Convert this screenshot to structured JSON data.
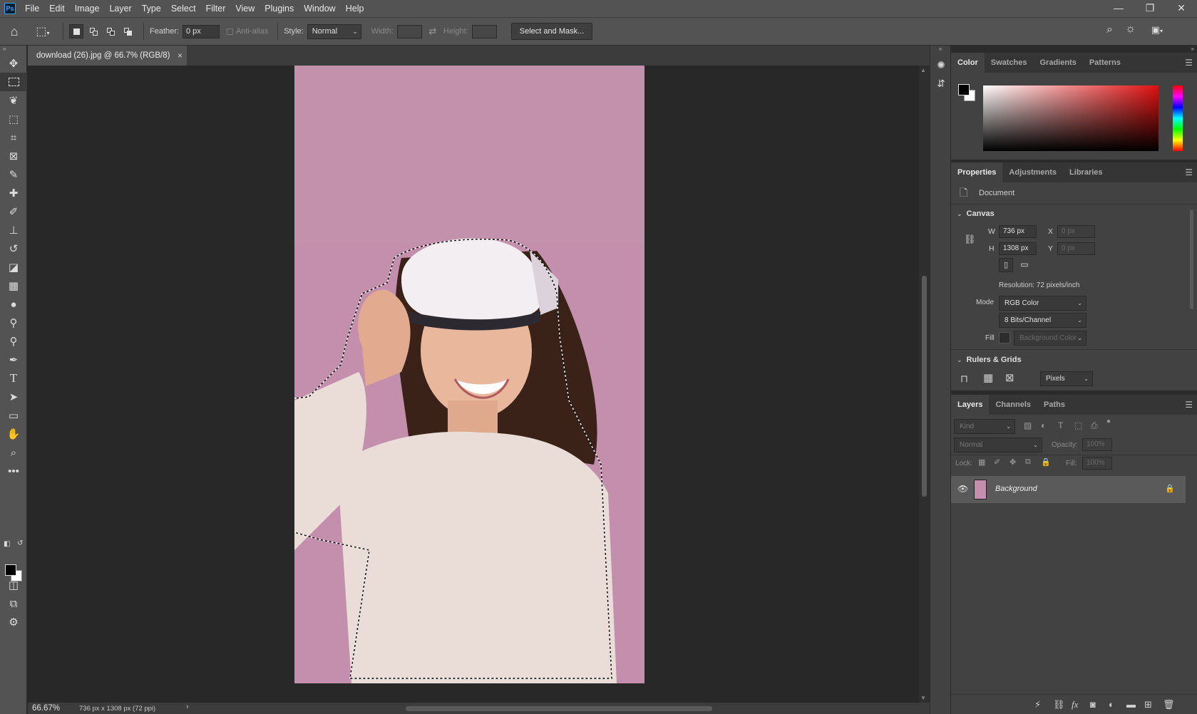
{
  "menubar": {
    "logo": "Ps",
    "items": [
      "File",
      "Edit",
      "Image",
      "Layer",
      "Type",
      "Select",
      "Filter",
      "View",
      "Plugins",
      "Window",
      "Help"
    ],
    "window_controls": {
      "minimize": "—",
      "restore": "❐",
      "close": "✕"
    }
  },
  "options": {
    "feather_label": "Feather:",
    "feather_value": "0 px",
    "antialias_label": "Anti-alias",
    "style_label": "Style:",
    "style_value": "Normal",
    "width_label": "Width:",
    "height_label": "Height:",
    "select_mask_label": "Select and Mask..."
  },
  "document": {
    "tab_title": "download (26).jpg @ 66.7% (RGB/8)",
    "close": "×",
    "zoom": "66.67%",
    "info": "736 px x 1308 px (72 ppi)",
    "image_bg": "#c48fad"
  },
  "color_panel": {
    "tabs": [
      "Color",
      "Swatches",
      "Gradients",
      "Patterns"
    ],
    "active_tab": "Color",
    "foreground": "#000000",
    "background": "#ffffff"
  },
  "properties_panel": {
    "tabs": [
      "Properties",
      "Adjustments",
      "Libraries"
    ],
    "active_tab": "Properties",
    "doc_label": "Document",
    "canvas_title": "Canvas",
    "w_label": "W",
    "w_value": "736 px",
    "h_label": "H",
    "h_value": "1308 px",
    "x_label": "X",
    "x_placeholder": "0 px",
    "y_label": "Y",
    "y_placeholder": "0 px",
    "resolution": "Resolution: 72 pixels/inch",
    "mode_label": "Mode",
    "mode_value": "RGB Color",
    "bits_value": "8 Bits/Channel",
    "fill_label": "Fill",
    "fill_value": "Background Color",
    "rulers_title": "Rulers & Grids",
    "units_value": "Pixels"
  },
  "layers_panel": {
    "tabs": [
      "Layers",
      "Channels",
      "Paths"
    ],
    "active_tab": "Layers",
    "filter_placeholder": "Kind",
    "blend_mode": "Normal",
    "opacity_label": "Opacity:",
    "opacity_value": "100%",
    "lock_label": "Lock:",
    "fill_label": "Fill:",
    "fill_value": "100%",
    "layers": [
      {
        "name": "Background",
        "visible": true,
        "locked": true
      }
    ]
  }
}
